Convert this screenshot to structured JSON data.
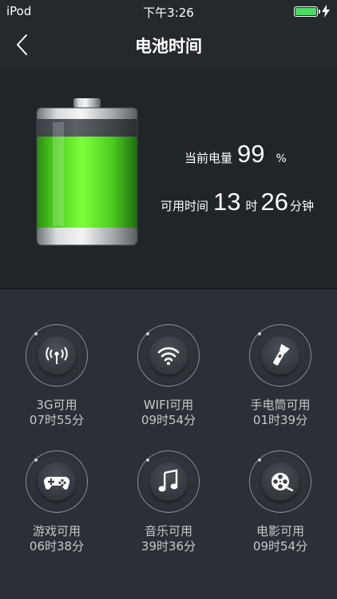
{
  "status_bar": {
    "device": "iPod",
    "time": "下午3:26"
  },
  "nav": {
    "title": "电池时间"
  },
  "battery": {
    "level_label": "当前电量",
    "level_value": "99",
    "level_unit": "%",
    "level_fraction": 0.99,
    "time_label": "可用时间",
    "hours": "13",
    "hours_unit": "时",
    "minutes": "26",
    "minutes_unit": "分钟"
  },
  "usage": [
    {
      "label": "3G可用",
      "time": "07时55分",
      "icon": "antenna-icon"
    },
    {
      "label": "WIFI可用",
      "time": "09时54分",
      "icon": "wifi-icon"
    },
    {
      "label": "手电筒可用",
      "time": "01时39分",
      "icon": "flashlight-icon"
    },
    {
      "label": "游戏可用",
      "time": "06时38分",
      "icon": "gamepad-icon"
    },
    {
      "label": "音乐可用",
      "time": "39时36分",
      "icon": "music-note-icon"
    },
    {
      "label": "电影可用",
      "time": "09时54分",
      "icon": "film-reel-icon"
    }
  ],
  "colors": {
    "accent_green": "#5ee52a",
    "background": "#2a3035",
    "status_battery": "#4cd964"
  }
}
